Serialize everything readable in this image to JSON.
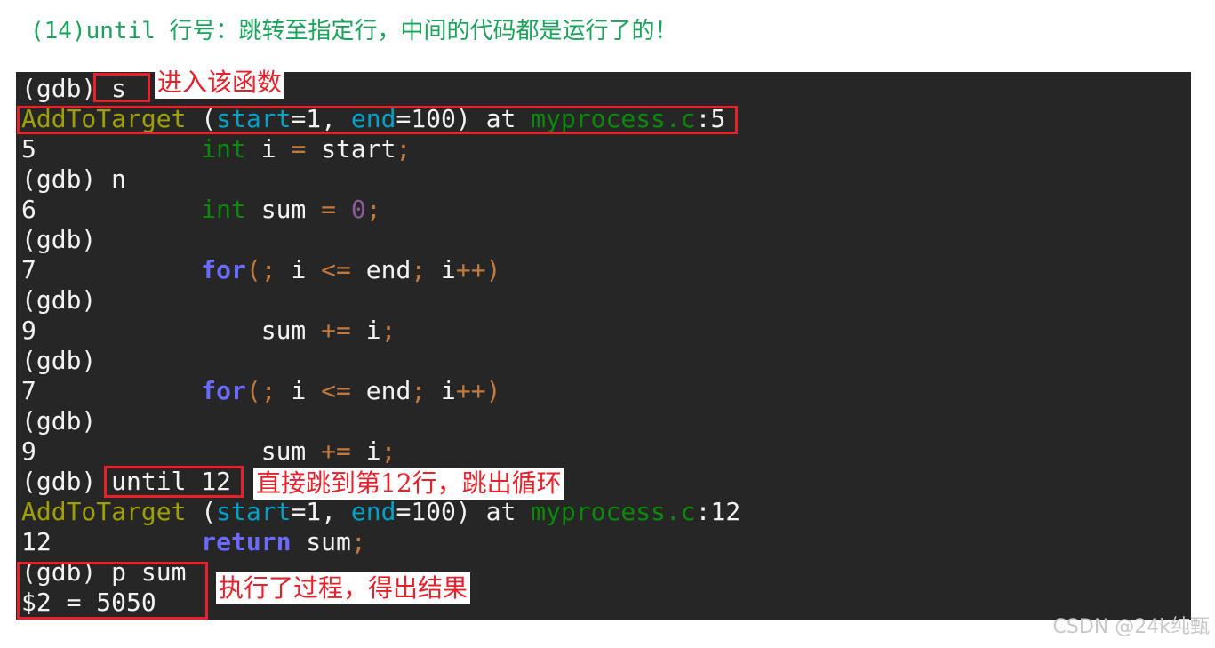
{
  "title": "(14)until 行号：跳转至指定行，中间的代码都是运行了的！",
  "colors": {
    "func": "#a0a000",
    "param": "#00a2c8",
    "file": "#0a8a0a",
    "operator": "#c07a40",
    "number": "#8a5a9a",
    "keyword": "#6a6aff",
    "annotation": "#e8202a",
    "title": "#1aa35a",
    "terminal_bg": "#262626"
  },
  "terminal": {
    "lines": [
      [
        {
          "t": "(gdb) s"
        }
      ],
      [
        {
          "t": "AddToTarget",
          "c": "func"
        },
        {
          "t": " ("
        },
        {
          "t": "start",
          "c": "param"
        },
        {
          "t": "=1, "
        },
        {
          "t": "end",
          "c": "param"
        },
        {
          "t": "=100) at "
        },
        {
          "t": "myprocess.c",
          "c": "file"
        },
        {
          "t": ":5"
        }
      ],
      [
        {
          "t": "5           "
        },
        {
          "t": "int",
          "c": "type"
        },
        {
          "t": " i "
        },
        {
          "t": "=",
          "c": "op"
        },
        {
          "t": " start"
        },
        {
          "t": ";",
          "c": "op"
        }
      ],
      [
        {
          "t": "(gdb) n"
        }
      ],
      [
        {
          "t": "6           "
        },
        {
          "t": "int",
          "c": "type"
        },
        {
          "t": " sum "
        },
        {
          "t": "=",
          "c": "op"
        },
        {
          "t": " "
        },
        {
          "t": "0",
          "c": "num"
        },
        {
          "t": ";",
          "c": "op"
        }
      ],
      [
        {
          "t": "(gdb)"
        }
      ],
      [
        {
          "t": "7           "
        },
        {
          "t": "for",
          "c": "kw"
        },
        {
          "t": "(;",
          "c": "op"
        },
        {
          "t": " i "
        },
        {
          "t": "<=",
          "c": "op"
        },
        {
          "t": " end"
        },
        {
          "t": ";",
          "c": "op"
        },
        {
          "t": " i"
        },
        {
          "t": "++)",
          "c": "op"
        }
      ],
      [
        {
          "t": "(gdb)"
        }
      ],
      [
        {
          "t": "9               sum "
        },
        {
          "t": "+=",
          "c": "op"
        },
        {
          "t": " i"
        },
        {
          "t": ";",
          "c": "op"
        }
      ],
      [
        {
          "t": "(gdb)"
        }
      ],
      [
        {
          "t": "7           "
        },
        {
          "t": "for",
          "c": "kw"
        },
        {
          "t": "(;",
          "c": "op"
        },
        {
          "t": " i "
        },
        {
          "t": "<=",
          "c": "op"
        },
        {
          "t": " end"
        },
        {
          "t": ";",
          "c": "op"
        },
        {
          "t": " i"
        },
        {
          "t": "++)",
          "c": "op"
        }
      ],
      [
        {
          "t": "(gdb)"
        }
      ],
      [
        {
          "t": "9               sum "
        },
        {
          "t": "+=",
          "c": "op"
        },
        {
          "t": " i"
        },
        {
          "t": ";",
          "c": "op"
        }
      ],
      [
        {
          "t": "(gdb) until 12"
        }
      ],
      [
        {
          "t": "AddToTarget",
          "c": "func"
        },
        {
          "t": " ("
        },
        {
          "t": "start",
          "c": "param"
        },
        {
          "t": "=1, "
        },
        {
          "t": "end",
          "c": "param"
        },
        {
          "t": "=100) at "
        },
        {
          "t": "myprocess.c",
          "c": "file"
        },
        {
          "t": ":12"
        }
      ],
      [
        {
          "t": "12          "
        },
        {
          "t": "return",
          "c": "kw"
        },
        {
          "t": " sum"
        },
        {
          "t": ";",
          "c": "op"
        }
      ],
      [
        {
          "t": "(gdb) p sum"
        }
      ],
      [
        {
          "t": "$2 = 5050"
        }
      ]
    ]
  },
  "annotations": {
    "step_into": "进入该函数",
    "until": "直接跳到第12行，跳出循环",
    "result": "执行了过程，得出结果"
  },
  "watermark": "CSDN @24k纯甄"
}
